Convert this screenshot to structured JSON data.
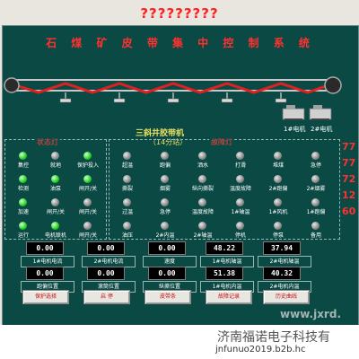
{
  "window": {
    "title": "?????????"
  },
  "system_title": "石 煤 矿 皮 带 集 中 控 制 系 统",
  "belt": {
    "name": "三斜井胶带机",
    "subtitle": "（14分站）"
  },
  "motors": [
    {
      "label": "1#电机"
    },
    {
      "label": "2#电机"
    }
  ],
  "status_panel": {
    "header": "状态灯"
  },
  "fault_panel": {
    "header": "故障灯"
  },
  "status_lamps": [
    {
      "label": "集控",
      "on": true
    },
    {
      "label": "就地",
      "on": false
    },
    {
      "label": "保护投入",
      "on": true
    },
    {
      "label": "检测",
      "on": true
    },
    {
      "label": "油泵",
      "on": true
    },
    {
      "label": "闸开/关",
      "on": true
    },
    {
      "label": "加速",
      "on": true
    },
    {
      "label": "闸开/关",
      "on": false
    },
    {
      "label": "闸开/关",
      "on": false
    },
    {
      "label": "运行",
      "on": true
    },
    {
      "label": "电机联机",
      "on": true
    },
    {
      "label": "闸开/关",
      "on": false
    }
  ],
  "fault_lamps": [
    {
      "label": "超温"
    },
    {
      "label": "跑偏"
    },
    {
      "label": "洒水"
    },
    {
      "label": "打滑"
    },
    {
      "label": "堆煤"
    },
    {
      "label": "急停"
    },
    {
      "label": "撕裂"
    },
    {
      "label": "烟雾"
    },
    {
      "label": "纵向撕裂"
    },
    {
      "label": "温度故障"
    },
    {
      "label": "2#跑偏"
    },
    {
      "label": "2#烟雾"
    },
    {
      "label": "过温"
    },
    {
      "label": "急停"
    },
    {
      "label": "温度故障"
    },
    {
      "label": "1#轴温"
    },
    {
      "label": "1#风机"
    },
    {
      "label": "1#跑偏"
    },
    {
      "label": "油压"
    },
    {
      "label": "2#内温"
    },
    {
      "label": "2#轴温"
    },
    {
      "label": "停机"
    },
    {
      "label": "停泵"
    },
    {
      "label": "备用"
    }
  ],
  "right_numbers": [
    "77",
    "77",
    "72",
    "12",
    "60"
  ],
  "meters": [
    {
      "value": "0.00",
      "label": "1#电机电流"
    },
    {
      "value": "0.00",
      "label": "2#电机电流"
    },
    {
      "value": "0.00",
      "label": "速度"
    },
    {
      "value": "48.22",
      "label": "1#电机轴温"
    },
    {
      "value": "37.94",
      "label": "2#电机轴温"
    },
    {
      "value": "0.00",
      "label": "跑偏位置"
    },
    {
      "value": "0.00",
      "label": "滚筒位置"
    },
    {
      "value": "0.00",
      "label": "纵撕位置"
    },
    {
      "value": "51.38",
      "label": "1#电机内温"
    },
    {
      "value": "40.32",
      "label": "2#电机内温"
    }
  ],
  "buttons": [
    {
      "label": "保护选择"
    },
    {
      "label": "启 停"
    },
    {
      "label": "皮带条"
    },
    {
      "label": "故障记录"
    },
    {
      "label": "历史曲线"
    }
  ],
  "watermark": "www.jxrd.",
  "footer": {
    "company": "济南福诺电子科技有",
    "url": "jnfunuo2019.b2b.hc"
  }
}
